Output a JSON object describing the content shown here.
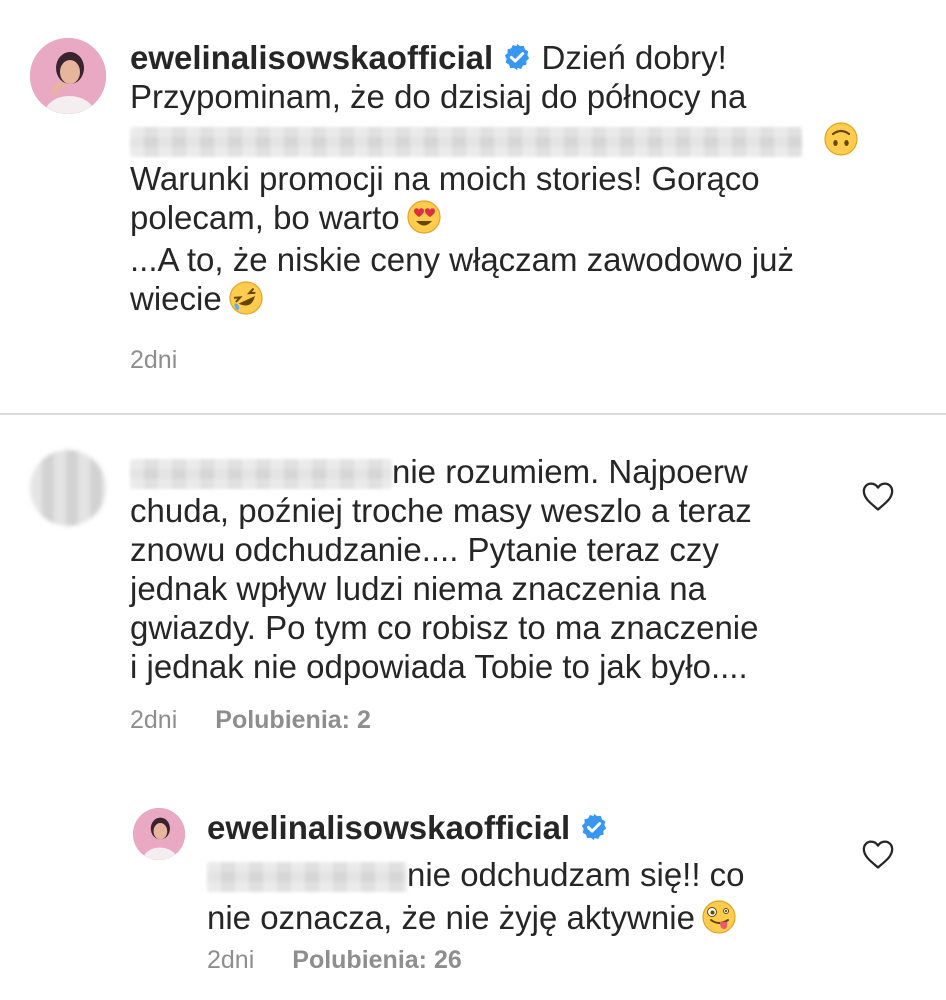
{
  "post": {
    "username": "ewelinalisowskaofficial",
    "line1_after_name": "Dzień dobry!",
    "line2": "Przypominam, że do dzisiaj do północy na",
    "line4": "Warunki promocji na moich stories! Gorąco",
    "line5": "polecam, bo warto",
    "line6": "...A to, że niskie ceny włączam zawodowo już",
    "line7": "wiecie",
    "time": "2dni"
  },
  "comment": {
    "line1": "nie rozumiem. Najpoerw",
    "line2": "chuda, poźniej troche masy weszlo a teraz",
    "line3": "znowu odchudzanie.... Pytanie teraz czy",
    "line4": "jednak wpływ ludzi niema znaczenia na",
    "line5": "gwiazdy. Po tym co robisz to ma znaczenie",
    "line6": "i jednak nie odpowiada Tobie to jak było....",
    "time": "2dni",
    "likes": "Polubienia: 2"
  },
  "reply": {
    "username": "ewelinalisowskaofficial",
    "line1": "nie odchudzam się!! co",
    "line2": "nie oznacza, że nie żyję aktywnie",
    "time": "2dni",
    "likes": "Polubienia: 26"
  },
  "icons": {
    "verified": "verified-badge-icon",
    "heart": "heart-outline-icon",
    "emoji_upside_down": "upside-down-face-emoji",
    "emoji_heart_eyes": "heart-eyes-emoji",
    "emoji_rofl": "rolling-on-floor-laughing-emoji",
    "emoji_zany": "zany-face-emoji"
  },
  "colors": {
    "verified": "#3897f0",
    "text": "#262626",
    "meta": "#8e8e8e",
    "divider": "#dbdbdb"
  }
}
